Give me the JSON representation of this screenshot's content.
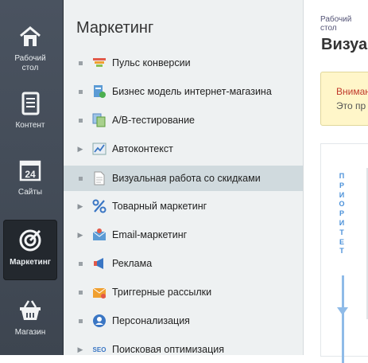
{
  "rail": {
    "items": [
      {
        "label_lines": [
          "Рабочий",
          "стол"
        ],
        "icon": "home-icon"
      },
      {
        "label_lines": [
          "Контент"
        ],
        "icon": "document-icon"
      },
      {
        "label_lines": [
          "Сайты"
        ],
        "icon": "calendar-icon",
        "icon_text": "24"
      },
      {
        "label_lines": [
          "Маркетинг"
        ],
        "icon": "target-icon",
        "active": true
      },
      {
        "label_lines": [
          "Магазин"
        ],
        "icon": "basket-icon"
      }
    ]
  },
  "menu": {
    "title": "Маркетинг",
    "items": [
      {
        "label": "Пульс конверсии",
        "marker": "square",
        "icon": "funnel-icon"
      },
      {
        "label": "Бизнес модель интернет-магазина",
        "marker": "square",
        "icon": "business-model-icon"
      },
      {
        "label": "A/B-тестирование",
        "marker": "square",
        "icon": "ab-test-icon"
      },
      {
        "label": "Автоконтекст",
        "marker": "arrow",
        "icon": "chart-icon"
      },
      {
        "label": "Визуальная работа со скидками",
        "marker": "square",
        "icon": "page-icon",
        "active": true
      },
      {
        "label": "Товарный маркетинг",
        "marker": "arrow",
        "icon": "percent-icon"
      },
      {
        "label": "Email-маркетинг",
        "marker": "arrow",
        "icon": "email-icon"
      },
      {
        "label": "Реклама",
        "marker": "square",
        "icon": "megaphone-icon"
      },
      {
        "label": "Триггерные рассылки",
        "marker": "square",
        "icon": "trigger-mail-icon"
      },
      {
        "label": "Персонализация",
        "marker": "square",
        "icon": "person-icon"
      },
      {
        "label": "Поисковая оптимизация",
        "marker": "arrow",
        "icon": "seo-icon"
      }
    ]
  },
  "content": {
    "breadcrumb": "Рабочий стол",
    "title": "Визуа",
    "alert_line1": "Внимание",
    "alert_line2": "Это пр",
    "priority_text": "ПРИОРИТЕТ"
  },
  "colors": {
    "accent": "#4a90d9",
    "rail_bg": "#434b56",
    "active_menu_bg": "#d0dade"
  }
}
